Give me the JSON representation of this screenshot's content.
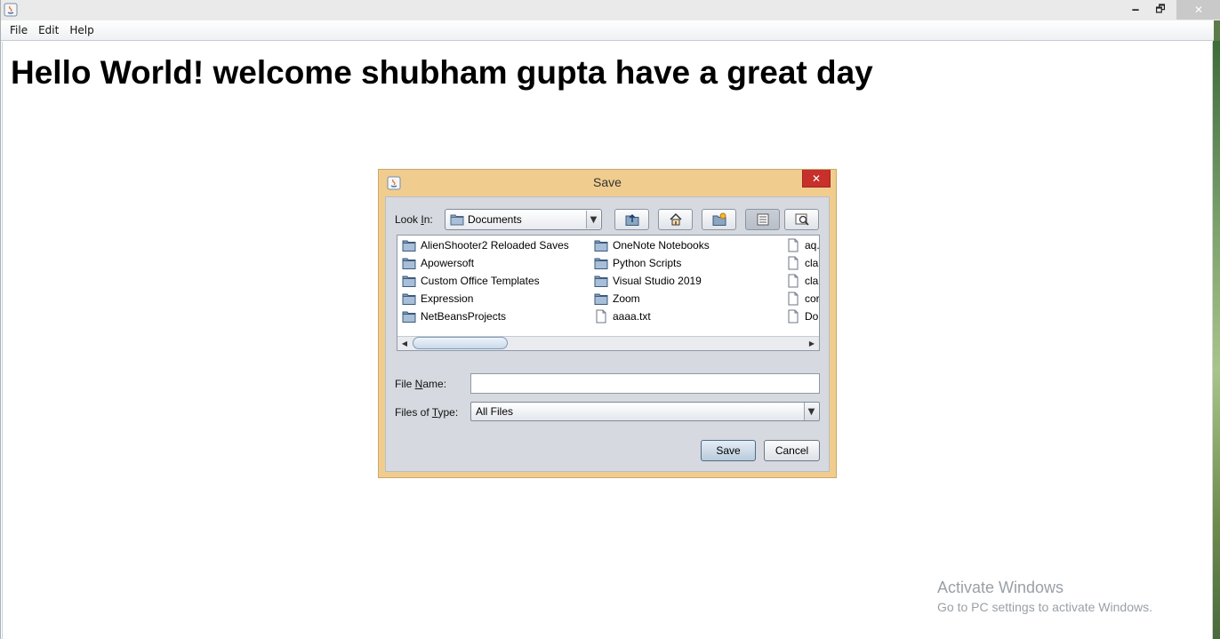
{
  "window": {
    "minimize_glyph": "🗕",
    "maximize_glyph": "🗗",
    "close_glyph": "✕"
  },
  "menubar": {
    "items": [
      "File",
      "Edit",
      "Help"
    ]
  },
  "content": {
    "heading": "Hello World! welcome shubham gupta have a great day"
  },
  "watermark": {
    "title": "Activate Windows",
    "subtitle": "Go to PC settings to activate Windows."
  },
  "dialog": {
    "title": "Save",
    "close_glyph": "✕",
    "look_in_label": "Look In:",
    "look_in_value": "Documents",
    "toolbar": {
      "up_icon": "up-folder-icon",
      "home_icon": "home-icon",
      "new_folder_icon": "new-folder-icon",
      "list_view_icon": "list-view-icon",
      "details_view_icon": "details-view-icon"
    },
    "files": {
      "col1": [
        "AlienShooter2 Reloaded Saves",
        "Apowersoft",
        "Custom Office Templates",
        "Expression",
        "NetBeansProjects"
      ],
      "col2": [
        "OneNote Notebooks",
        "Python Scripts",
        "Visual Studio 2019",
        "Zoom",
        "aaaa.txt"
      ],
      "col3": [
        "aq.",
        "cla",
        "cla",
        "cor",
        "Do"
      ]
    },
    "file_name_label": "File Name:",
    "file_name_value": "",
    "files_of_type_label": "Files of Type:",
    "files_of_type_value": "All Files",
    "save_label": "Save",
    "cancel_label": "Cancel"
  }
}
